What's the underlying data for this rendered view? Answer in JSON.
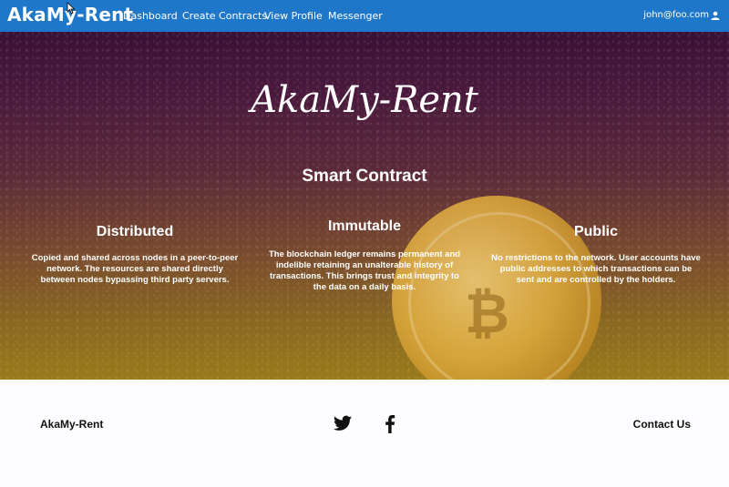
{
  "nav": {
    "brand": "AkaMy-Rent",
    "links": [
      "Dashboard",
      "Create Contracts",
      "View Profile",
      "Messenger"
    ],
    "user_email": "john@foo.com",
    "user_icon": "user-icon"
  },
  "hero": {
    "title": "AkaMy-Rent",
    "section_title": "Smart Contract",
    "features": [
      {
        "title": "Distributed",
        "text": "Copied and shared across nodes in a peer-to-peer network. The resources are shared directly between nodes bypassing third party servers."
      },
      {
        "title": "Immutable",
        "text": "The blockchain ledger remains permanent and indelible retaining an unalterable history of transactions. This brings trust and integrity to the data on a daily basis."
      },
      {
        "title": "Public",
        "text": "No restrictions to the network. User accounts have public addresses to which transactions can be sent and are controlled by the holders."
      }
    ]
  },
  "footer": {
    "brand": "AkaMy-Rent",
    "contact": "Contact Us",
    "social_icons": [
      "twitter-icon",
      "facebook-icon"
    ]
  },
  "colors": {
    "navbar": "#1f77c9",
    "hero_top": "#3a1036",
    "hero_bottom": "#9a7a1c",
    "footer_bg": "#fdfdff"
  }
}
